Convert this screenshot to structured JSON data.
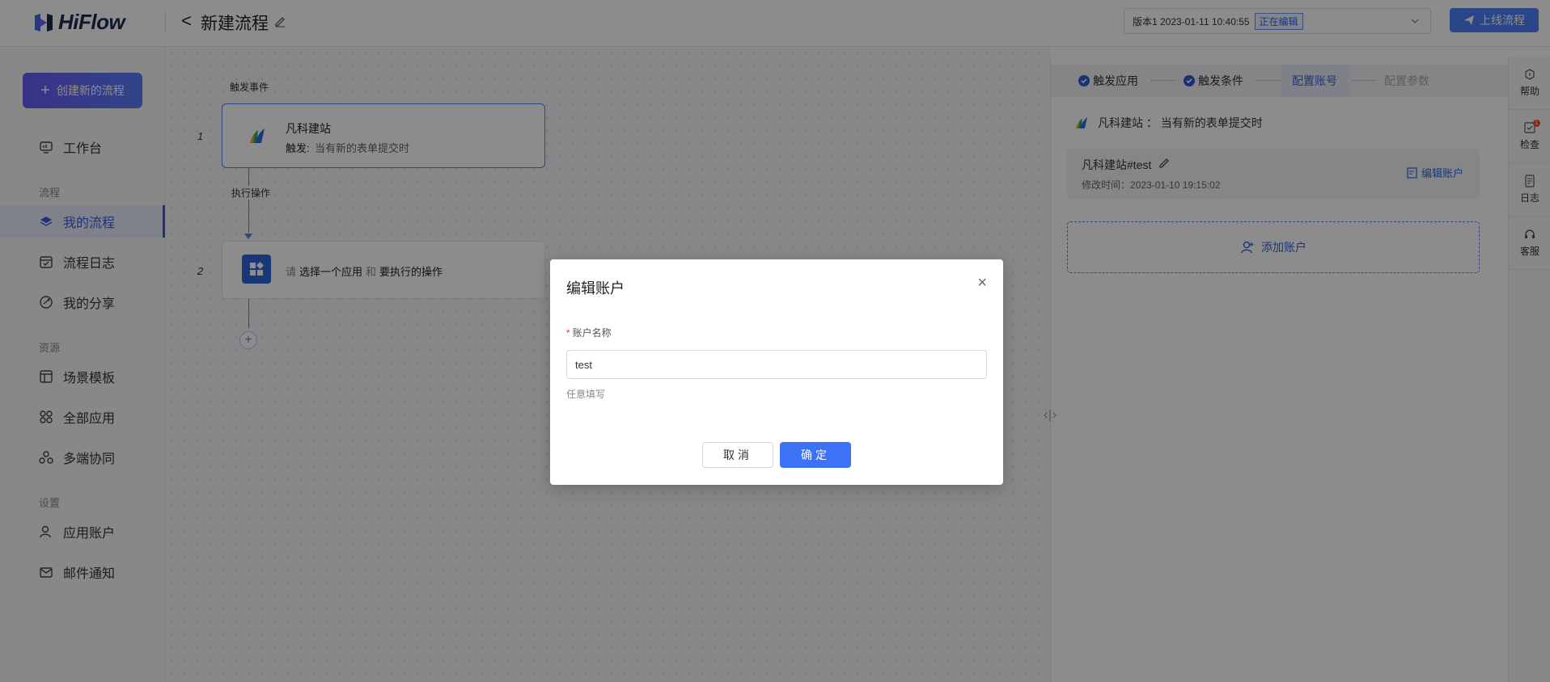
{
  "app": {
    "name": "HiFlow",
    "flow_title": "新建流程",
    "back_glyph": "<"
  },
  "version": {
    "text": "版本1  2023-01-11 10:40:55",
    "status": "正在编辑"
  },
  "header": {
    "publish_label": "上线流程"
  },
  "sidebar": {
    "create_label": "创建新的流程",
    "workbench": "工作台",
    "section_flow": "流程",
    "my_flows": "我的流程",
    "flow_logs": "流程日志",
    "my_shares": "我的分享",
    "section_resources": "资源",
    "templates": "场景模板",
    "all_apps": "全部应用",
    "multi_collab": "多端协同",
    "section_settings": "设置",
    "app_accounts": "应用账户",
    "email_notify": "邮件通知"
  },
  "canvas": {
    "trigger_event_label": "触发事件",
    "action_label": "执行操作",
    "step1_num": "1",
    "step2_num": "2",
    "node1_title": "凡科建站",
    "node1_trigger_prefix": "触发:",
    "node1_trigger_value": "当有新的表单提交时",
    "node2_p1": "请",
    "node2_p2": "选择一个应用",
    "node2_p3": "和",
    "node2_p4": "要执行的操作",
    "add_glyph": "+"
  },
  "right_panel": {
    "steps": [
      "触发应用",
      "触发条件",
      "配置账号",
      "配置参数"
    ],
    "app_line": "凡科建站 ：  当有新的表单提交时",
    "account_name": "凡科建站#test",
    "account_modified": "修改时间：2023-01-10 19:15:02",
    "edit_account_label": "编辑账户",
    "add_account_label": "添加账户"
  },
  "right_toolbar": {
    "help": "帮助",
    "check": "检查",
    "check_badge": "1",
    "log": "日志",
    "service": "客服"
  },
  "modal": {
    "title": "编辑账户",
    "close_glyph": "×",
    "required_mark": "*",
    "field_label": "账户名称",
    "field_value": "test",
    "field_hint": "任意填写",
    "cancel_label": "取消",
    "ok_label": "确定"
  },
  "colors": {
    "accent": "#3b72f6",
    "brand_purple": "#6a5cf7",
    "active_nav": "#3a5bd9"
  }
}
